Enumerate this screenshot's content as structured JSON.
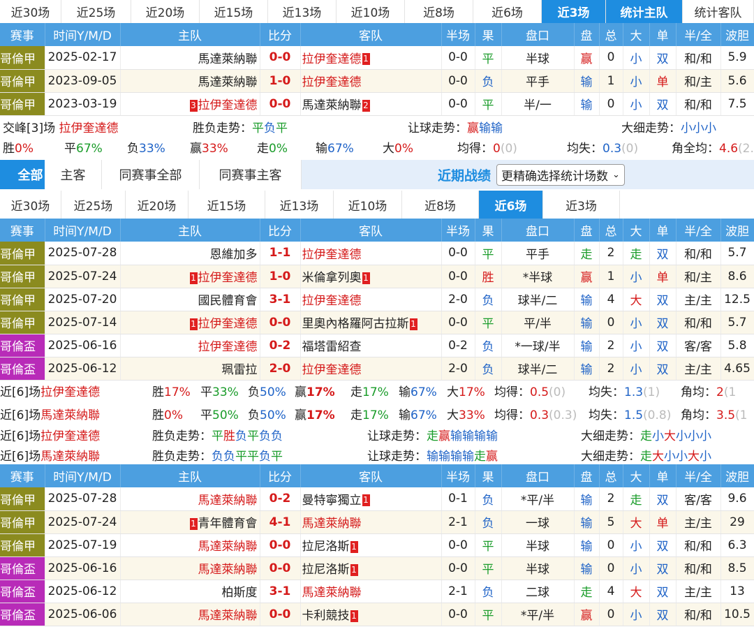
{
  "colors": {
    "tab_active": "#1e8de0",
    "header": "#4c9fe0",
    "league_colombia": "#8b8b1f",
    "league_cup": "#b82bb8",
    "highlight": "#d51a1a",
    "blue": "#1f63c7",
    "green": "#1a9c2a"
  },
  "top_tabs": [
    "近30场",
    "近25场",
    "近20场",
    "近15场",
    "近13场",
    "近10场",
    "近8场",
    "近6场",
    "近3场",
    "统计主队",
    "统计客队"
  ],
  "headers": [
    "赛事",
    "时间Y/M/D",
    "主队",
    "比分",
    "客队",
    "半场",
    "果",
    "盘口",
    "盘",
    "总",
    "大",
    "单",
    "半/全",
    "波胆"
  ],
  "h2h_rows": [
    {
      "league": "哥倫甲",
      "date": "2025-02-17",
      "home": "馬達萊納聯",
      "home_card": "",
      "score": "0-0",
      "away": "拉伊奎達德",
      "away_card": "1",
      "half": "0-0",
      "result": "平",
      "handicap": "半球",
      "pan": "赢",
      "total": "0",
      "big": "小",
      "odd": "双",
      "hf": "和/和",
      "odds": "5.9"
    },
    {
      "league": "哥倫甲",
      "date": "2023-09-05",
      "home": "馬達萊納聯",
      "home_card": "",
      "score": "1-0",
      "away": "拉伊奎達德",
      "away_card": "",
      "half": "0-0",
      "result": "负",
      "handicap": "平手",
      "pan": "输",
      "total": "1",
      "big": "小",
      "odd": "单",
      "hf": "和/主",
      "odds": "5.6"
    },
    {
      "league": "哥倫甲",
      "date": "2023-03-19",
      "home": "拉伊奎達德",
      "home_card": "3",
      "score": "0-0",
      "away": "馬達萊納聯",
      "away_card": "2",
      "half": "0-0",
      "result": "平",
      "handicap": "半/一",
      "pan": "输",
      "total": "0",
      "big": "小",
      "odd": "双",
      "hf": "和/和",
      "odds": "7.5"
    }
  ],
  "h2h_summary": {
    "line1": {
      "label_a": "交峰[",
      "count": "3",
      "label_b": "]场",
      "team": "拉伊奎達德",
      "wl_label": "胜负走势：",
      "wl": [
        "平",
        "负",
        "平"
      ],
      "hc_label": "让球走势：",
      "hc": [
        "赢",
        "输",
        "输"
      ],
      "bs_label": "大细走势：",
      "bs": [
        "小",
        "小",
        "小"
      ]
    },
    "line2": {
      "win_l": "胜",
      "win": "0%",
      "draw_l": "平",
      "draw": "67%",
      "loss_l": "负",
      "loss": "33%",
      "ying_l": "赢",
      "ying": "33%",
      "zou_l": "走",
      "zou": "0%",
      "shu_l": "输",
      "shu": "67%",
      "da_l": "大",
      "da": "0%",
      "jd_l": "均得：",
      "jd": "0",
      "jd_p": "(0)",
      "js_l": "均失：",
      "js": "0.3",
      "js_p": "(0)",
      "jq_l": "角全均：",
      "jq": "4.6",
      "jq_p": "(2."
    }
  },
  "section2": {
    "tabs": [
      "全部",
      "主客",
      "同赛事全部",
      "同赛事主客"
    ],
    "title": "近期战绩",
    "select": "更精确选择统计场数",
    "select_icon": "chevron-down"
  },
  "mid_tabs": [
    "近30场",
    "近25场",
    "近20场",
    "近15场",
    "近13场",
    "近10场",
    "近8场",
    "近6场",
    "近3场"
  ],
  "team1_rows": [
    {
      "league": "哥倫甲",
      "cup": false,
      "date": "2025-07-28",
      "home": "恩維加多",
      "home_card": "",
      "home_hl": false,
      "score": "1-1",
      "away": "拉伊奎達德",
      "away_card": "",
      "away_hl": true,
      "half": "0-0",
      "result": "平",
      "handicap": "平手",
      "pan": "走",
      "total": "2",
      "big": "走",
      "odd": "双",
      "hf": "和/和",
      "odds": "5.7"
    },
    {
      "league": "哥倫甲",
      "cup": false,
      "date": "2025-07-24",
      "home": "拉伊奎達德",
      "home_card": "1",
      "home_hl": true,
      "score": "1-0",
      "away": "米倫拿列奧",
      "away_card": "1",
      "away_hl": false,
      "half": "0-0",
      "result": "胜",
      "handicap": "*半球",
      "pan": "赢",
      "total": "1",
      "big": "小",
      "odd": "单",
      "hf": "和/主",
      "odds": "8.6"
    },
    {
      "league": "哥倫甲",
      "cup": false,
      "date": "2025-07-20",
      "home": "國民體育會",
      "home_card": "",
      "home_hl": false,
      "score": "3-1",
      "away": "拉伊奎達德",
      "away_card": "",
      "away_hl": true,
      "half": "2-0",
      "result": "负",
      "handicap": "球半/二",
      "pan": "输",
      "total": "4",
      "big": "大",
      "odd": "双",
      "hf": "主/主",
      "odds": "12.5"
    },
    {
      "league": "哥倫甲",
      "cup": false,
      "date": "2025-07-14",
      "home": "拉伊奎達德",
      "home_card": "1",
      "home_hl": true,
      "score": "0-0",
      "away": "里奧內格羅阿古拉斯",
      "away_card": "1",
      "away_hl": false,
      "half": "0-0",
      "result": "平",
      "handicap": "平/半",
      "pan": "输",
      "total": "0",
      "big": "小",
      "odd": "双",
      "hf": "和/和",
      "odds": "5.7"
    },
    {
      "league": "哥倫盃",
      "cup": true,
      "date": "2025-06-16",
      "home": "拉伊奎達德",
      "home_card": "",
      "home_hl": true,
      "score": "0-2",
      "away": "福塔雷紹查",
      "away_card": "",
      "away_hl": false,
      "half": "0-2",
      "result": "负",
      "handicap": "*一球/半",
      "pan": "输",
      "total": "2",
      "big": "小",
      "odd": "双",
      "hf": "客/客",
      "odds": "5.8"
    },
    {
      "league": "哥倫盃",
      "cup": true,
      "date": "2025-06-12",
      "home": "珮雷拉",
      "home_card": "",
      "home_hl": false,
      "score": "2-0",
      "away": "拉伊奎達德",
      "away_card": "",
      "away_hl": true,
      "half": "2-0",
      "result": "负",
      "handicap": "球半/二",
      "pan": "输",
      "total": "2",
      "big": "小",
      "odd": "双",
      "hf": "主/主",
      "odds": "4.65"
    }
  ],
  "recent_stats": [
    {
      "prefix": "近[",
      "n": "6",
      "suffix": "]场",
      "team": "拉伊奎達德",
      "win": "17%",
      "draw": "33%",
      "loss": "50%",
      "ying": "17%",
      "zou": "17%",
      "shu": "67%",
      "da": "17%",
      "jd": "0.5",
      "jd_p": "(0)",
      "js": "1.3",
      "js_p": "(1)",
      "jq": "2",
      "jq_p": "(1"
    },
    {
      "prefix": "近[",
      "n": "6",
      "suffix": "]场",
      "team": "馬達萊納聯",
      "win": "0%",
      "draw": "50%",
      "loss": "50%",
      "ying": "17%",
      "zou": "17%",
      "shu": "67%",
      "da": "33%",
      "jd": "0.3",
      "jd_p": "(0.3)",
      "js": "1.5",
      "js_p": "(0.8)",
      "jq": "3.5",
      "jq_p": "(1"
    }
  ],
  "stat_labels": {
    "win": "胜",
    "draw": "平",
    "loss": "负",
    "ying": "赢",
    "zou": "走",
    "shu": "输",
    "da": "大",
    "jd": "均得：",
    "js": "均失：",
    "jq": "角均："
  },
  "trends": [
    {
      "prefix": "近[",
      "n": "6",
      "suffix": "]场",
      "team": "拉伊奎達德",
      "wl_label": "胜负走势：",
      "wl": [
        "平",
        "胜",
        "负",
        "平",
        "负",
        "负"
      ],
      "hc_label": "让球走势：",
      "hc": [
        "走",
        "赢",
        "输",
        "输",
        "输",
        "输"
      ],
      "bs_label": "大细走势：",
      "bs": [
        "走",
        "小",
        "大",
        "小",
        "小",
        "小"
      ]
    },
    {
      "prefix": "近[",
      "n": "6",
      "suffix": "]场",
      "team": "馬達萊納聯",
      "wl_label": "胜负走势：",
      "wl": [
        "负",
        "负",
        "平",
        "平",
        "负",
        "平"
      ],
      "hc_label": "让球走势：",
      "hc": [
        "输",
        "输",
        "输",
        "输",
        "走",
        "赢"
      ],
      "bs_label": "大细走势：",
      "bs": [
        "走",
        "大",
        "小",
        "小",
        "大",
        "小"
      ]
    }
  ],
  "team2_rows": [
    {
      "league": "哥倫甲",
      "cup": false,
      "date": "2025-07-28",
      "home": "馬達萊納聯",
      "home_card": "",
      "home_hl": true,
      "score": "0-2",
      "away": "曼特寧獨立",
      "away_card": "1",
      "away_hl": false,
      "half": "0-1",
      "result": "负",
      "handicap": "*平/半",
      "pan": "输",
      "total": "2",
      "big": "走",
      "odd": "双",
      "hf": "客/客",
      "odds": "9.6"
    },
    {
      "league": "哥倫甲",
      "cup": false,
      "date": "2025-07-24",
      "home": "青年體育會",
      "home_card": "1",
      "home_hl": false,
      "score": "4-1",
      "away": "馬達萊納聯",
      "away_card": "",
      "away_hl": true,
      "half": "2-1",
      "result": "负",
      "handicap": "一球",
      "pan": "输",
      "total": "5",
      "big": "大",
      "odd": "单",
      "hf": "主/主",
      "odds": "29"
    },
    {
      "league": "哥倫甲",
      "cup": false,
      "date": "2025-07-19",
      "home": "馬達萊納聯",
      "home_card": "",
      "home_hl": true,
      "score": "0-0",
      "away": "拉尼洛斯",
      "away_card": "1",
      "away_hl": false,
      "half": "0-0",
      "result": "平",
      "handicap": "半球",
      "pan": "输",
      "total": "0",
      "big": "小",
      "odd": "双",
      "hf": "和/和",
      "odds": "6.3"
    },
    {
      "league": "哥倫盃",
      "cup": true,
      "date": "2025-06-16",
      "home": "馬達萊納聯",
      "home_card": "",
      "home_hl": true,
      "score": "0-0",
      "away": "拉尼洛斯",
      "away_card": "1",
      "away_hl": false,
      "half": "0-0",
      "result": "平",
      "handicap": "半球",
      "pan": "输",
      "total": "0",
      "big": "小",
      "odd": "双",
      "hf": "和/和",
      "odds": "8.5"
    },
    {
      "league": "哥倫盃",
      "cup": true,
      "date": "2025-06-12",
      "home": "柏斯度",
      "home_card": "",
      "home_hl": false,
      "score": "3-1",
      "away": "馬達萊納聯",
      "away_card": "",
      "away_hl": true,
      "half": "2-1",
      "result": "负",
      "handicap": "二球",
      "pan": "走",
      "total": "4",
      "big": "大",
      "odd": "双",
      "hf": "主/主",
      "odds": "13"
    },
    {
      "league": "哥倫盃",
      "cup": true,
      "date": "2025-06-06",
      "home": "馬達萊納聯",
      "home_card": "",
      "home_hl": true,
      "score": "0-0",
      "away": "卡利競技",
      "away_card": "1",
      "away_hl": false,
      "half": "0-0",
      "result": "平",
      "handicap": "*平/半",
      "pan": "赢",
      "total": "0",
      "big": "小",
      "odd": "双",
      "hf": "和/和",
      "odds": "10.5"
    }
  ]
}
